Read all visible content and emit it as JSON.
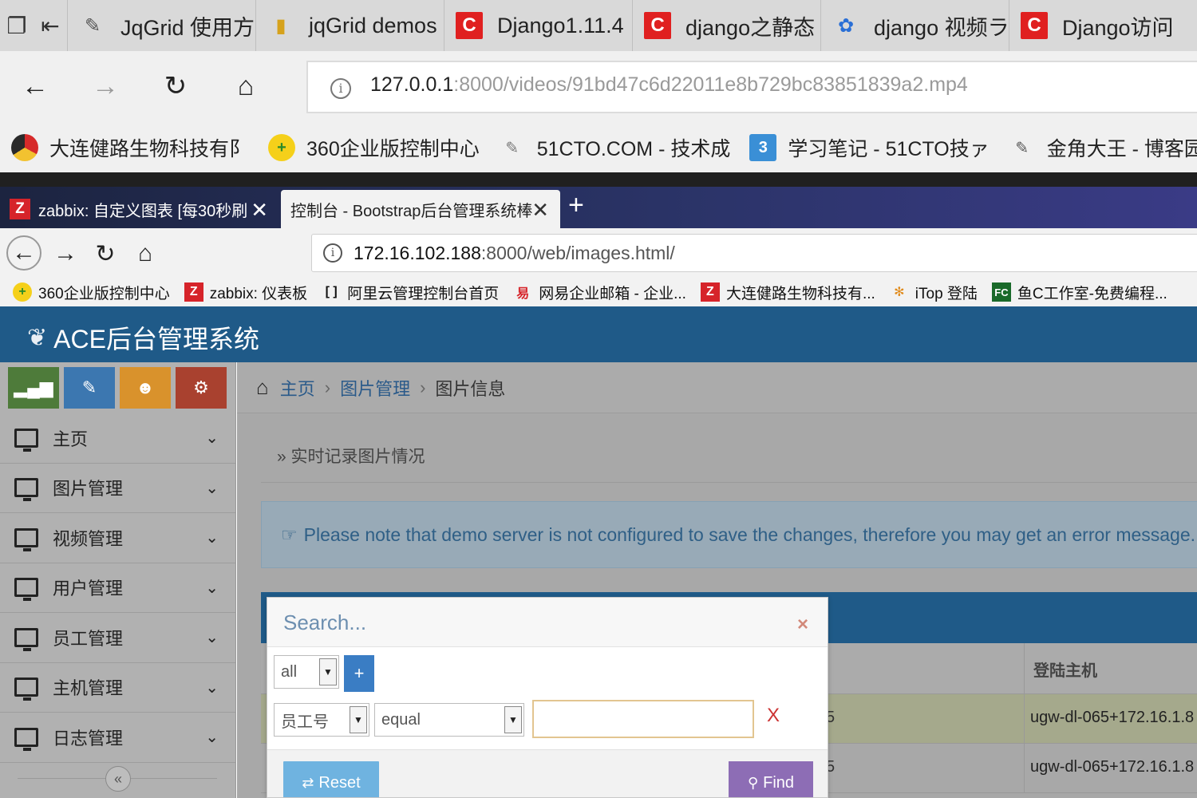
{
  "colors": {
    "ace_header": "#1f5a88",
    "breadcrumb_link": "#2a5a8a",
    "alert_text": "#2f5f86",
    "find_button": "#8d6db5",
    "reset_button": "#6fb3e0",
    "add_button": "#3a7dc4"
  },
  "outer_browser": {
    "tabs": [
      {
        "icon": "pen-icon",
        "title": "JqGrid 使用方"
      },
      {
        "icon": "folder-icon",
        "title": "jqGrid demos"
      },
      {
        "icon": "c-logo-icon",
        "title": "Django1.11.4"
      },
      {
        "icon": "c-logo-icon",
        "title": "django之静态"
      },
      {
        "icon": "baidu-paw-icon",
        "title": "django 视频ラ"
      },
      {
        "icon": "c-logo-icon",
        "title": "Django访问"
      }
    ],
    "address": {
      "host": "127.0.0.1",
      "rest": ":8000/videos/91bd47c6d22011e8b729bc83851839a2.mp4"
    },
    "bookmarks": [
      {
        "icon": "globe-icon",
        "label": "大连健路生物科技有阝"
      },
      {
        "icon": "plus-circle-icon",
        "label": "360企业版控制中心"
      },
      {
        "icon": "pen-icon",
        "label": "51CTO.COM - 技术成"
      },
      {
        "icon": "three-icon",
        "label": "学习笔记 - 51CTO技ァ"
      },
      {
        "icon": "pen-icon",
        "label": "金角大王 - 博客园"
      },
      {
        "icon": "study-icon",
        "label": "៛"
      }
    ]
  },
  "inner_browser": {
    "tabs": [
      {
        "icon": "zabbix-icon",
        "title": "zabbix: 自定义图表 [每30秒刷"
      },
      {
        "icon": "",
        "title": "控制台 - Bootstrap后台管理系统棒"
      }
    ],
    "new_tab": "+",
    "address": {
      "host": "172.16.102.188",
      "rest": ":8000/web/images.html/"
    },
    "bookmarks": [
      {
        "icon": "plus-circle-icon",
        "label": "360企业版控制中心"
      },
      {
        "icon": "zabbix-icon",
        "label": "zabbix: 仪表板"
      },
      {
        "icon": "aliyun-icon",
        "label": "阿里云管理控制台首页"
      },
      {
        "icon": "netease-icon",
        "label": "网易企业邮箱 - 企业..."
      },
      {
        "icon": "zabbix-icon",
        "label": "大连健路生物科技有..."
      },
      {
        "icon": "itop-icon",
        "label": "iTop 登陆"
      },
      {
        "icon": "fc-icon",
        "label": "鱼C工作室-免费编程..."
      }
    ]
  },
  "app": {
    "brand": "ACE后台管理系统",
    "sidebar": {
      "shortcuts": [
        "signal-icon",
        "pencil-icon",
        "users-icon",
        "cogs-icon"
      ],
      "items": [
        {
          "label": "主页"
        },
        {
          "label": "图片管理"
        },
        {
          "label": "视频管理"
        },
        {
          "label": "用户管理"
        },
        {
          "label": "员工管理"
        },
        {
          "label": "主机管理"
        },
        {
          "label": "日志管理"
        }
      ],
      "collapse_symbol": "«"
    },
    "breadcrumb": {
      "home": "主页",
      "section": "图片管理",
      "current": "图片信息"
    },
    "page_subtitle": "» 实时记录图片情况",
    "alert": "Please note that demo server is not configured to save the changes, therefore you may get an error message.",
    "grid": {
      "columns": [
        "登陆主机"
      ],
      "rows": [
        {
          "col_a": "5",
          "host": "ugw-dl-065+172.16.1.8"
        },
        {
          "col_a": "5",
          "host": "ugw-dl-065+172.16.1.8"
        }
      ]
    },
    "search_dialog": {
      "title": "Search...",
      "close": "×",
      "group_op": "all",
      "add_symbol": "+",
      "field": "员工号",
      "operator": "equal",
      "value": "",
      "delete_symbol": "X",
      "reset_label": "Reset",
      "find_label": "Find"
    }
  }
}
